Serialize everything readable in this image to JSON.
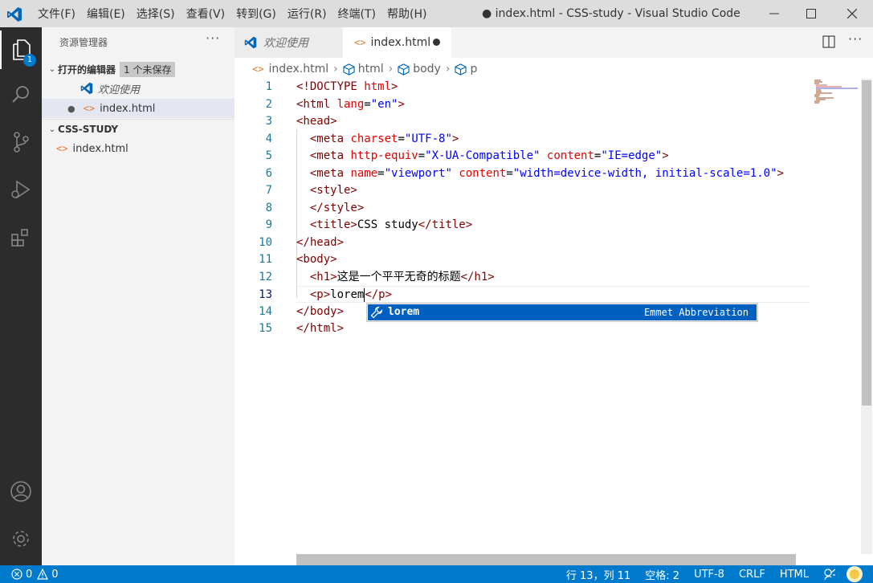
{
  "titlebar": {
    "menu": [
      "文件(F)",
      "编辑(E)",
      "选择(S)",
      "查看(V)",
      "转到(G)",
      "运行(R)",
      "终端(T)",
      "帮助(H)"
    ],
    "window_title": "● index.html - CSS-study - Visual Studio Code"
  },
  "activity": {
    "explorer_badge": "1"
  },
  "sidebar": {
    "title": "资源管理器",
    "more": "···",
    "open_editors": {
      "label": "打开的编辑器",
      "unsaved": "1 个未保存"
    },
    "open_items": [
      "欢迎使用",
      "index.html"
    ],
    "folder": {
      "label": "CSS-STUDY",
      "items": [
        "index.html"
      ]
    }
  },
  "tabs": [
    {
      "label": "欢迎使用",
      "icon": "vscode-logo-icon"
    },
    {
      "label": "index.html",
      "icon": "html-file-icon",
      "dirty": true
    }
  ],
  "breadcrumb": [
    "index.html",
    "html",
    "body",
    "p"
  ],
  "editor": {
    "lines": [
      {
        "n": "1",
        "tokens": [
          [
            "tg",
            "<!DOCTYPE "
          ],
          [
            "at",
            "html"
          ],
          [
            "tg",
            ">"
          ]
        ]
      },
      {
        "n": "2",
        "tokens": [
          [
            "tg",
            "<html "
          ],
          [
            "at",
            "lang"
          ],
          [
            "p",
            "="
          ],
          [
            "st",
            "\"en\""
          ],
          [
            "tg",
            ">"
          ]
        ]
      },
      {
        "n": "3",
        "tokens": [
          [
            "tg",
            "<head>"
          ]
        ]
      },
      {
        "n": "4",
        "tokens": [
          [
            "p",
            "  "
          ],
          [
            "tg",
            "<meta "
          ],
          [
            "at",
            "charset"
          ],
          [
            "p",
            "="
          ],
          [
            "st",
            "\"UTF-8\""
          ],
          [
            "tg",
            ">"
          ]
        ]
      },
      {
        "n": "5",
        "tokens": [
          [
            "p",
            "  "
          ],
          [
            "tg",
            "<meta "
          ],
          [
            "at",
            "http-equiv"
          ],
          [
            "p",
            "="
          ],
          [
            "st",
            "\"X-UA-Compatible\""
          ],
          [
            "p",
            " "
          ],
          [
            "at",
            "content"
          ],
          [
            "p",
            "="
          ],
          [
            "st",
            "\"IE=edge\""
          ],
          [
            "tg",
            ">"
          ]
        ]
      },
      {
        "n": "6",
        "tokens": [
          [
            "p",
            "  "
          ],
          [
            "tg",
            "<meta "
          ],
          [
            "at",
            "name"
          ],
          [
            "p",
            "="
          ],
          [
            "st",
            "\"viewport\""
          ],
          [
            "p",
            " "
          ],
          [
            "at",
            "content"
          ],
          [
            "p",
            "="
          ],
          [
            "st",
            "\"width=device-width, initial-scale=1.0\""
          ],
          [
            "tg",
            ">"
          ]
        ]
      },
      {
        "n": "7",
        "tokens": [
          [
            "p",
            "  "
          ],
          [
            "tg",
            "<style>"
          ]
        ]
      },
      {
        "n": "8",
        "tokens": [
          [
            "p",
            "  "
          ],
          [
            "tg",
            "</style>"
          ]
        ]
      },
      {
        "n": "9",
        "tokens": [
          [
            "p",
            "  "
          ],
          [
            "tg",
            "<title>"
          ],
          [
            "p",
            "CSS study"
          ],
          [
            "tg",
            "</title>"
          ]
        ]
      },
      {
        "n": "10",
        "tokens": [
          [
            "tg",
            "</head>"
          ]
        ]
      },
      {
        "n": "11",
        "tokens": [
          [
            "tg",
            "<body>"
          ]
        ]
      },
      {
        "n": "12",
        "tokens": [
          [
            "p",
            "  "
          ],
          [
            "tg",
            "<h1>"
          ],
          [
            "p",
            "这是一个平平无奇的标题"
          ],
          [
            "tg",
            "</h1>"
          ]
        ]
      },
      {
        "n": "13",
        "tokens": [
          [
            "p",
            "  "
          ],
          [
            "tg",
            "<p>"
          ],
          [
            "p",
            "lorem"
          ],
          [
            "cursor",
            ""
          ],
          [
            "tg",
            "</p>"
          ]
        ]
      },
      {
        "n": "14",
        "tokens": [
          [
            "tg",
            "</body>"
          ]
        ]
      },
      {
        "n": "15",
        "tokens": [
          [
            "tg",
            "</html>"
          ]
        ]
      }
    ],
    "current_line": "13"
  },
  "suggest": {
    "label": "lorem",
    "detail": "Emmet Abbreviation"
  },
  "status": {
    "errors": "0",
    "warnings": "0",
    "position": "行 13，列 11",
    "spaces": "空格: 2",
    "encoding": "UTF-8",
    "eol": "CRLF",
    "language": "HTML"
  },
  "colors": {
    "accent": "#007acc",
    "tag": "#800000",
    "attr": "#e50000",
    "string": "#0000ff",
    "linenum": "#237893"
  }
}
